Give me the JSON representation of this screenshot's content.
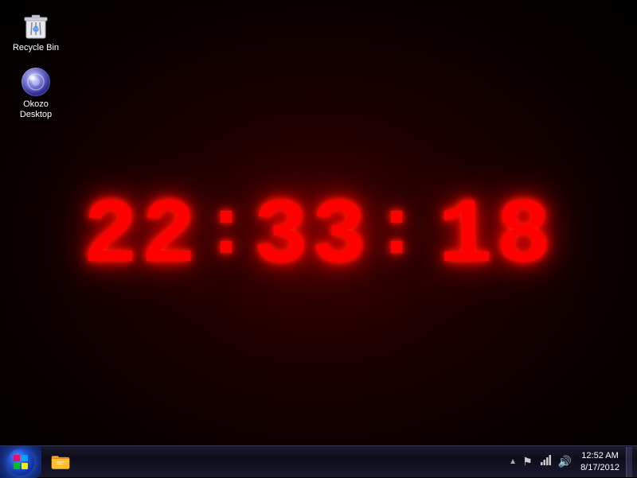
{
  "desktop": {
    "background": "dark red radial",
    "icons": [
      {
        "id": "recycle-bin",
        "label": "Recycle Bin",
        "type": "recycle-bin"
      },
      {
        "id": "okozo-desktop",
        "label": "Okozo\nDesktop",
        "labelLine1": "Okozo",
        "labelLine2": "Desktop",
        "type": "okozo"
      }
    ]
  },
  "clock": {
    "hours": "22",
    "minutes": "33",
    "seconds": "18",
    "display": "22:33: 18"
  },
  "taskbar": {
    "startLabel": "",
    "pinnedItems": [
      {
        "id": "explorer",
        "label": "Windows Explorer"
      }
    ],
    "tray": {
      "time": "12:52 AM",
      "date": "8/17/2012",
      "icons": [
        "arrow-up",
        "flag",
        "network",
        "speaker"
      ]
    }
  }
}
